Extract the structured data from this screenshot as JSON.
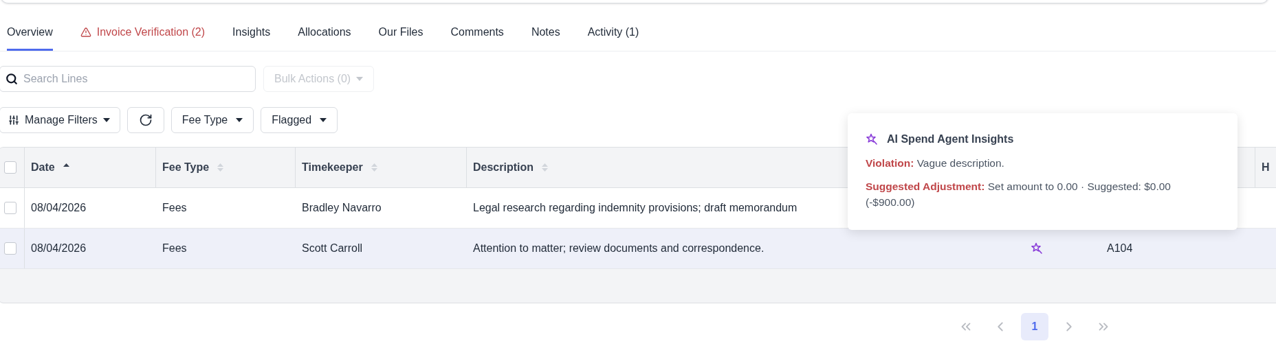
{
  "tabs": [
    {
      "label": "Overview",
      "selected": true,
      "warning": false
    },
    {
      "label": "Invoice Verification (2)",
      "selected": false,
      "warning": true
    },
    {
      "label": "Insights",
      "selected": false,
      "warning": false
    },
    {
      "label": "Allocations",
      "selected": false,
      "warning": false
    },
    {
      "label": "Our Files",
      "selected": false,
      "warning": false
    },
    {
      "label": "Comments",
      "selected": false,
      "warning": false
    },
    {
      "label": "Notes",
      "selected": false,
      "warning": false
    },
    {
      "label": "Activity (1)",
      "selected": false,
      "warning": false
    }
  ],
  "search": {
    "placeholder": "Search Lines"
  },
  "bulk_actions": {
    "label": "Bulk Actions (0)",
    "disabled": true
  },
  "filters": [
    {
      "kind": "manage",
      "label": "Manage Filters"
    },
    {
      "kind": "refresh"
    },
    {
      "kind": "dropdown",
      "label": "Fee Type"
    },
    {
      "kind": "dropdown",
      "label": "Flagged"
    }
  ],
  "table": {
    "select_all": {
      "checked": false
    },
    "columns": [
      {
        "label": "Date",
        "sorted": true
      },
      {
        "label": "Fee Type",
        "sorted": false
      },
      {
        "label": "Timekeeper",
        "sorted": false
      },
      {
        "label": "Description",
        "sorted": false
      },
      {
        "label": "H"
      }
    ],
    "rows": [
      {
        "checked": false,
        "hovered": false,
        "date": "08/04/2026",
        "fee_type": "Fees",
        "timekeeper": "Bradley Navarro",
        "description": "Legal research regarding indemnity provisions; draft memorandum"
      },
      {
        "checked": false,
        "hovered": true,
        "date": "08/04/2026",
        "fee_type": "Fees",
        "timekeeper": "Scott Carroll",
        "description": "Attention to matter; review documents and correspondence.",
        "flagged": true,
        "code": "A104"
      }
    ]
  },
  "tooltip": {
    "title": "AI Spend Agent Insights",
    "lines": [
      {
        "label": "Violation:",
        "text": "Vague description."
      },
      {
        "label": "Suggested Adjustment:",
        "text": "Set amount to 0.00 · Suggested: $0.00 (-$900.00)"
      }
    ]
  },
  "pagination": {
    "pages": [
      {
        "label": "1",
        "selected": true
      }
    ]
  }
}
